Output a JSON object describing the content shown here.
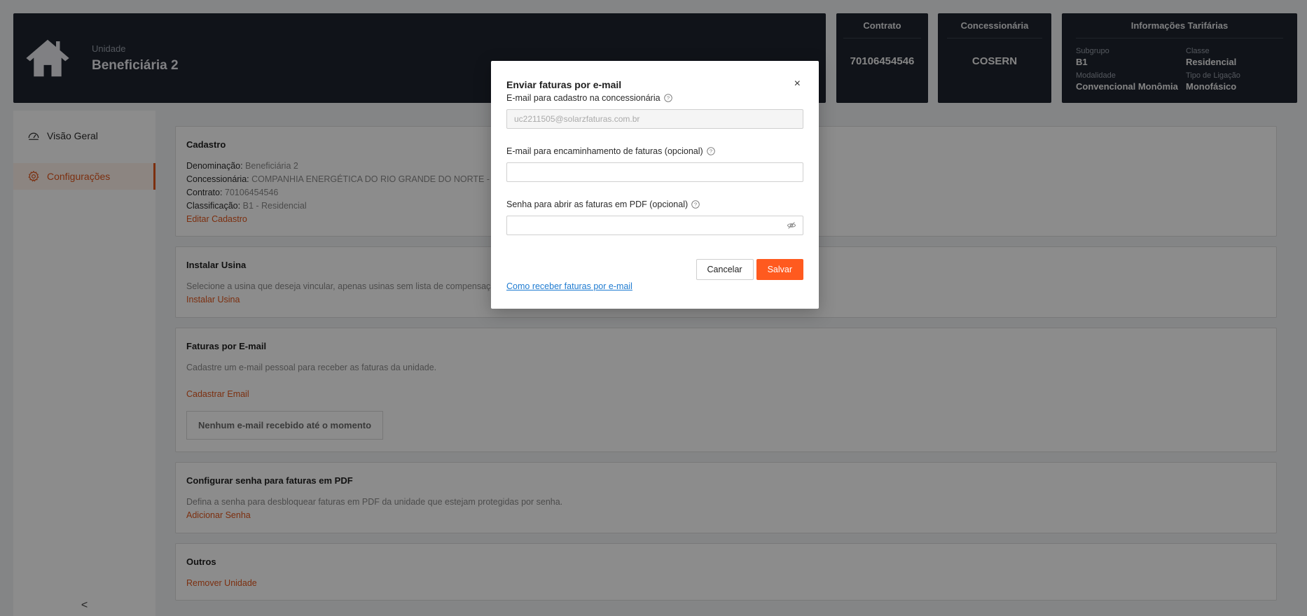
{
  "header": {
    "unit_label": "Unidade",
    "unit_name": "Beneficiária 2",
    "contract": {
      "title": "Contrato",
      "value": "70106454546"
    },
    "concessionaire": {
      "title": "Concessionária",
      "value": "COSERN"
    },
    "tariff": {
      "title": "Informações Tarifárias",
      "subgroup_label": "Subgrupo",
      "subgroup_value": "B1",
      "class_label": "Classe",
      "class_value": "Residencial",
      "modality_label": "Modalidade",
      "modality_value": "Convencional Monômia",
      "connection_label": "Tipo de Ligação",
      "connection_value": "Monofásico"
    }
  },
  "sidebar": {
    "items": [
      {
        "label": "Visão Geral",
        "icon": "dashboard-icon"
      },
      {
        "label": "Configurações",
        "icon": "gear-icon"
      }
    ],
    "collapse": "<"
  },
  "sections": {
    "cadastro": {
      "title": "Cadastro",
      "denominacao_label": "Denominação:",
      "denominacao_value": "Beneficiária 2",
      "concessionaria_label": "Concessionária:",
      "concessionaria_value": "COMPANHIA ENERGÉTICA DO RIO GRANDE DO NORTE - COS",
      "contrato_label": "Contrato:",
      "contrato_value": "70106454546",
      "classificacao_label": "Classificação:",
      "classificacao_value": "B1 - Residencial",
      "edit_link": "Editar Cadastro"
    },
    "usina": {
      "title": "Instalar Usina",
      "text": "Selecione a usina que deseja vincular, apenas usinas sem lista de compensaçã",
      "link": "Instalar Usina"
    },
    "faturas": {
      "title": "Faturas por E-mail",
      "text": "Cadastre um e-mail pessoal para receber as faturas da unidade.",
      "link": "Cadastrar Email",
      "empty": "Nenhum e-mail recebido até o momento"
    },
    "senha": {
      "title": "Configurar senha para faturas em PDF",
      "text": "Defina a senha para desbloquear faturas em PDF da unidade que estejam protegidas por senha.",
      "link": "Adicionar Senha"
    },
    "outros": {
      "title": "Outros",
      "link": "Remover Unidade"
    }
  },
  "modal": {
    "title": "Enviar faturas por e-mail",
    "close": "×",
    "email_label": "E-mail para cadastro na concessionária",
    "email_value": "uc2211505@solarzfaturas.com.br",
    "forward_label": "E-mail para encaminhamento de faturas (opcional)",
    "forward_value": "",
    "password_label": "Senha para abrir as faturas em PDF (opcional)",
    "password_value": "",
    "cancel": "Cancelar",
    "save": "Salvar",
    "help_link": "Como receber faturas por e-mail"
  },
  "colors": {
    "accent": "#ff5a1f",
    "header_bg": "#1e232e",
    "link_blue": "#1e7bd1"
  }
}
